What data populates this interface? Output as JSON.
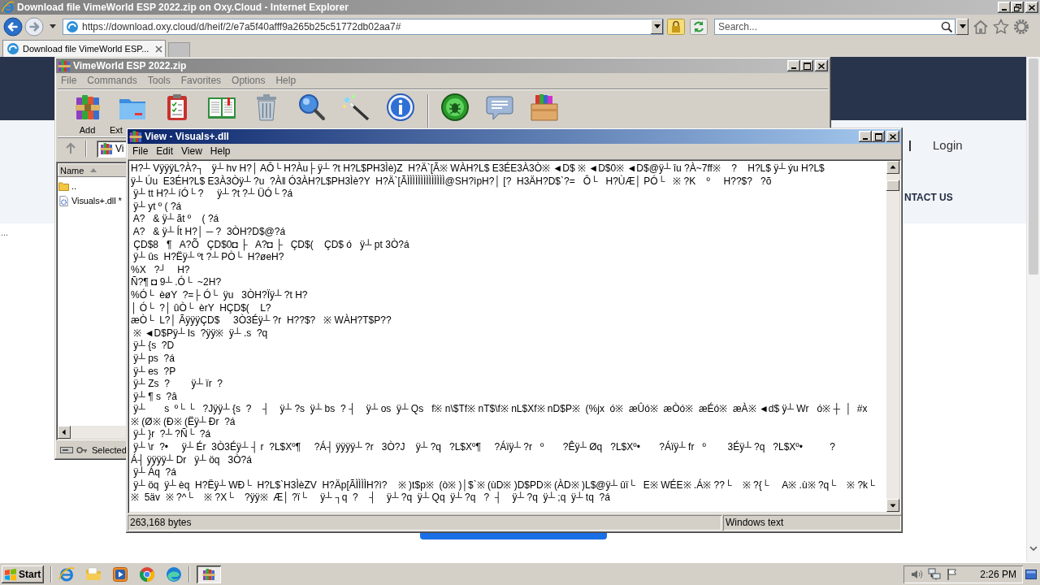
{
  "browser": {
    "title": "Download file VimeWorld ESP 2022.zip on Oxy.Cloud - Internet Explorer",
    "active": false,
    "url": "https://download.oxy.cloud/d/heif/2/e7a5f40afff9a265b25c51772db02aa7#",
    "search_placeholder": "Search...",
    "tabs": [
      {
        "label": "Download file VimeWorld ESP...",
        "selected": true
      }
    ]
  },
  "page": {
    "login": "Login",
    "contact": "NTACT US",
    "side_text": "..."
  },
  "winrar": {
    "title": "VimeWorld ESP 2022.zip",
    "active": false,
    "menu": [
      {
        "label": "File",
        "disabled": true
      },
      {
        "label": "Commands",
        "disabled": true
      },
      {
        "label": "Tools",
        "disabled": true
      },
      {
        "label": "Favorites",
        "disabled": true
      },
      {
        "label": "Options",
        "disabled": true
      },
      {
        "label": "Help",
        "disabled": true
      }
    ],
    "toolbar_groups": [
      [
        {
          "kind": "add",
          "label": "Add"
        },
        {
          "kind": "extract",
          "label": "Ext"
        },
        {
          "kind": "test"
        },
        {
          "kind": "view"
        },
        {
          "kind": "delete"
        },
        {
          "kind": "find"
        },
        {
          "kind": "wizard"
        },
        {
          "kind": "info"
        }
      ],
      [
        {
          "kind": "virus_scan"
        },
        {
          "kind": "comment"
        },
        {
          "kind": "sfx"
        }
      ]
    ],
    "path": "Vi",
    "columns": [
      {
        "label": "Name"
      }
    ],
    "files": [
      {
        "kind": "parent",
        "name": ".."
      },
      {
        "kind": "file",
        "name": "Visuals+.dll *"
      }
    ],
    "status": "Selected"
  },
  "viewer": {
    "title": "View - Visuals+.dll",
    "active": true,
    "menu": [
      {
        "label": "File",
        "disabled": false
      },
      {
        "label": "Edit",
        "disabled": false
      },
      {
        "label": "View",
        "disabled": false
      },
      {
        "label": "Help",
        "disabled": false
      }
    ],
    "lines": [
      "H?┴ VÿÿÿL?À?┐   ÿ┴ hv H?│ AÔ└ H?Àu├ ÿ┴ ?t H?L$PH3Ìè)Z  H?Ä`[Ã※ WÀH?L$ E3ÉE3À3Ò※ ◄D$ ※ ◄D$0※ ◄D$@ÿ┴ îu ?À~7ff※    ?    H?L$ ÿ┴ ýu H?L$",
      "ÿ┴ Úu  E3ÉH?L$ E3À3Òÿ┴ ?u  ?À‖ Ó3ÀH?L$PH3Ìè?Y  H?Ä`[ÃÌÌÌÌÌÌÌÌÌÌÌÌÌÌ@SH?ìpH?│ [?  H3ÄH?D$`?=   Ô└   H?ÙÆ│ PÓ└   ※ ?K    º     H??$?   ?õ",
      " ÿ┴ tt H?┴ íÓ└ ?     ÿ┴ ?t ?┴ ÜÓ└ ?á",
      " ÿ┴ yt º ( ?á",
      " A?   & ÿ┴ ãt º    ( ?á",
      " A?   & ÿ┴ Ít H?│ ─ ?  3ÒH?D$@?á",
      " ÇD$8   ¶   A?Õ   ÇD$0◘ ├   A?◘ ├   ÇD$(    ÇD$ ó   ÿ┴ pt 3Ò?á",
      " ÿ┴ ûs  H?Ëÿ┴ ºt ?┴ PÒ└  H?øeH?",
      "%X   ?┘    H?",
      "Ñ?¶ ◘ 9┴ .Ó└  ~2H?",
      "%Ó└  èøY  ?=├ Ó└  ÿu   3ÒH?Ïÿ┴ ?t H?",
      "│ Ó└  ?│ ûÒ└  èrY  HÇD$(    L?",
      "æÒ└  L?│ ÃÿÿÿÇD$     3Ò3Éÿ┴ ?r  H??$?   ※ WÀH?T$P??",
      " ※ ◄D$Pÿ┴ Is  ?ÿÿ※  ÿ┴ .s  ?q",
      " ÿ┴ {s  ?D",
      " ÿ┴ ps  ?á",
      " ÿ┴ es  ?P",
      " ÿ┴ Zs  ?        ÿ┴ ïr  ?",
      " ÿ┴ ¶ s  ?â",
      " ÿ┴       s  º└ └   ?Jÿÿ┴ {s  ?    ┤    ÿ┴ ?s  ÿ┴ bs  ? ┤    ÿ┴ os  ÿ┴ Qs   f※ n\\$Tf※ nT$\\f※ nL$Xf※ nD$P※  (%jx  ó※  æÛó※  æÒó※  æÉó※  æÀ※ ◄d$ ÿ┴ Wr   ó※ ┼  │  #x",
      "※ (Ø※ (Ð※ (Ëÿ┴ Ðr  ?á",
      " ÿ┴ }r  ?┴ ?Ñ└  ?á",
      " ÿ┴ \\r  ?•     ÿ┴ Ér  3Ò3Éÿ┴ ┤ r  ?L$Xº¶     ?Á┤ ÿÿÿÿ┴ ?r   3Ò?J    ÿ┴ ?q   ?L$Xº¶     ?Áïÿ┴ ?r   º       ?Êÿ┴ Øq   ?L$Xº•       ?Áïÿ┴ fr   º        3Éÿ┴ ?q   ?L$Xº•          ?",
      "Á┤ ÿÿÿÿ┴ Dr   ÿ┴ öq   3Ò?á",
      " ÿ┴ Áq  ?á",
      " ÿ┴ öq  ÿ┴ èq  H?Ëÿ┴ WÐ└  H?L$`H3ÌèZV  H?Äp[ÃÌÌÌÌH?ì?    ※ )t$p※  (ò※ )│$`※ (ùD※ )D$PD※ (ÀD※ )L$@ÿ┴ ûï└   E※ WÉE※ .Á※ ??└    ※ ?{└     A※ .ù※ ?q└    ※ ?k└",
      "※  5äv  ※ ?^└    ※ ?X└    ?ÿÿ※  Æ│ ?ï└     ÿ┴ ┐q  ?    ┤    ÿ┴ ?q  ÿ┴ Qq  ÿ┴ ?q   ?  ┤    ÿ┴ ?q  ÿ┴ ;q  ÿ┴ tq  ?á"
    ],
    "size": "263,168 bytes",
    "encoding": "Windows text"
  },
  "taskbar": {
    "start": "Start",
    "tasks": [
      {
        "selected": true
      }
    ],
    "clock": "2:26 PM"
  }
}
